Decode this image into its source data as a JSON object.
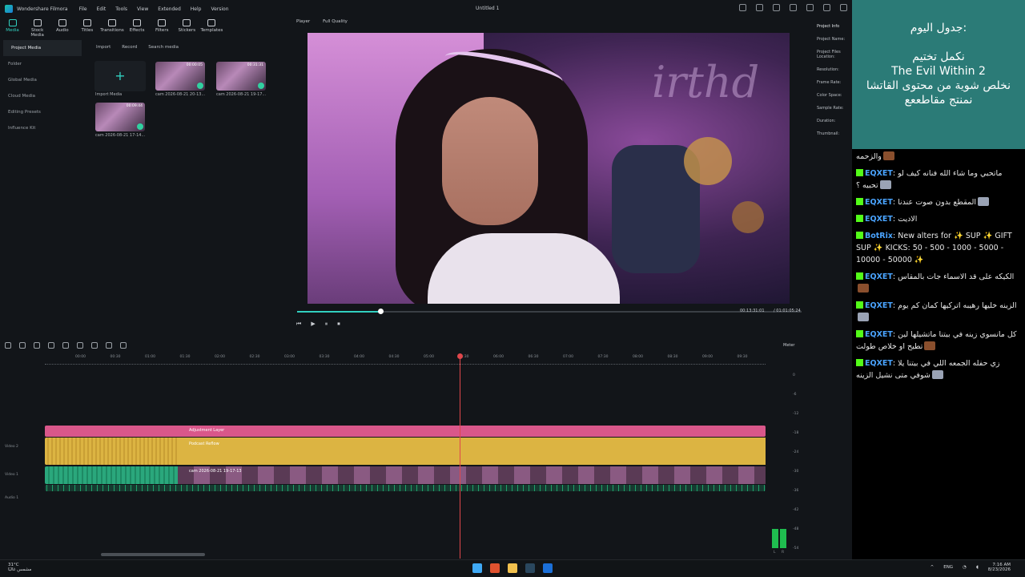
{
  "window": {
    "app_name": "Wondershare Filmora",
    "doc_title": "Untitled 1",
    "menus": [
      "File",
      "Edit",
      "Tools",
      "View",
      "Extended",
      "Help",
      "Version"
    ]
  },
  "toolbar": [
    "Media",
    "Stock Media",
    "Audio",
    "Titles",
    "Transitions",
    "Effects",
    "Filters",
    "Stickers",
    "Templates"
  ],
  "sidebar": [
    "Project Media",
    "Folder",
    "Global Media",
    "Cloud Media",
    "Editing Presets",
    "Influence Kit"
  ],
  "media": {
    "import_label": "Import",
    "record_label": "Record",
    "search_placeholder": "Search media",
    "import_media": "Import Media",
    "clips": [
      {
        "caption": "cam 2026-08-21 20-13...",
        "duration": "00:00:05"
      },
      {
        "caption": "cam 2026-08-21 19-17...",
        "duration": "00:31:31"
      },
      {
        "caption": "cam 2026-08-21 17-14...",
        "duration": "00:09:44"
      }
    ]
  },
  "player": {
    "label": "Player",
    "quality": "Full Quality",
    "current_time": "00:13:31:01",
    "total_time": "/ 01:01:05:24",
    "progress_fraction": 0.165
  },
  "project_info": [
    "Project Info",
    "Project Name:",
    "Project Files Location:",
    "Resolution:",
    "Frame Rate:",
    "Color Space:",
    "Sample Rate:",
    "Duration:",
    "Thumbnail:"
  ],
  "timeline": {
    "ruler": [
      "00:00",
      "00:30",
      "01:00",
      "01:30",
      "02:00",
      "02:30",
      "03:00",
      "03:30",
      "04:00",
      "04:30",
      "05:00",
      "05:30",
      "06:00",
      "06:30",
      "07:00",
      "07:30",
      "08:00",
      "08:30",
      "09:00",
      "09:30",
      "10:00",
      "10:30"
    ],
    "tracks": {
      "adjustment": "Adjustment Layer",
      "podcast": "Podcast Reflow",
      "video": "cam 2026-08-21 19-17-13",
      "video2": "Video 2",
      "video1": "Video 1",
      "audio1": "Audio 1"
    },
    "meter_label": "Meter",
    "meter_ticks": [
      "0",
      "-6",
      "-12",
      "-18",
      "-24",
      "-30",
      "-36",
      "-42",
      "-48",
      "-54",
      "-60"
    ],
    "meter_lr": [
      "L",
      "R"
    ]
  },
  "taskbar": {
    "temp": "31°C",
    "weather": "مشمس غالبًا",
    "lang": "ENG",
    "time": "7:16 AM",
    "date": "8/23/2026"
  },
  "schedule": {
    "title": "جدول اليوم:",
    "lines": [
      "نكمل تختيم",
      "The Evil Within 2",
      "نخلص شوية من محتوى القاتشا",
      "نمنتج مقاطععع"
    ]
  },
  "chat": [
    {
      "user": "",
      "text": "والزحمه"
    },
    {
      "user": "EQXET",
      "text": "ماتحبي وما شاء الله فنانه كيف لو تحبيه ؟"
    },
    {
      "user": "EQXET",
      "text": "المقطع بدون صوت عندنا"
    },
    {
      "user": "EQXET",
      "text": "الاديت"
    },
    {
      "user": "BotRix",
      "text": "New alters for ✨ SUP ✨ GIFT SUP ✨ KICKS: 50 - 500 - 1000 - 5000 - 10000 - 50000 ✨"
    },
    {
      "user": "EQXET",
      "text": "الكيكه على قد الاسماء جات بالمقاس"
    },
    {
      "user": "EQXET",
      "text": "الزينه خليها رهيبه اتركيها كمان كم يوم"
    },
    {
      "user": "EQXET",
      "text": "كل مانسوي زينه في بيتنا ماتشيلها لين تطيح او خلاص طولت"
    },
    {
      "user": "EQXET",
      "text": "زي حفله الجمعه اللي في بيتنا يلا شوفي متى نشيل الزينه"
    }
  ]
}
